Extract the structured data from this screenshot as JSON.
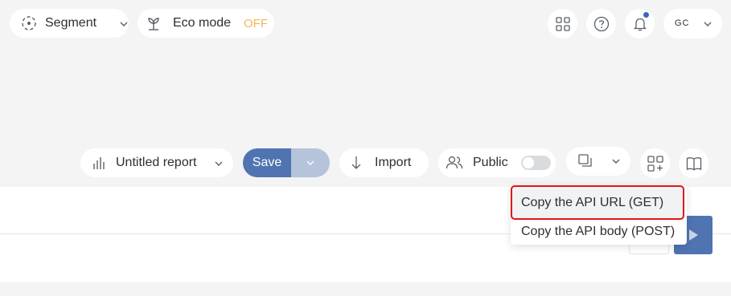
{
  "topbar": {
    "segment_label": "Segment",
    "eco_label": "Eco mode",
    "eco_state": "OFF",
    "user_initials": "GC"
  },
  "toolbar": {
    "report_name": "Untitled report",
    "save_label": "Save",
    "import_label": "Import",
    "visibility_label": "Public",
    "visibility_on": false
  },
  "menu": {
    "items": [
      {
        "label": "Copy the API URL (GET)",
        "highlighted": true
      },
      {
        "label": "Copy the API body (POST)",
        "highlighted": false
      }
    ]
  },
  "colors": {
    "accent": "#4f74b1",
    "save_dropdown": "#b5c3db",
    "eco_off": "#f3b45a",
    "notification_dot": "#3a66b8",
    "highlight_border": "#e0161c"
  }
}
